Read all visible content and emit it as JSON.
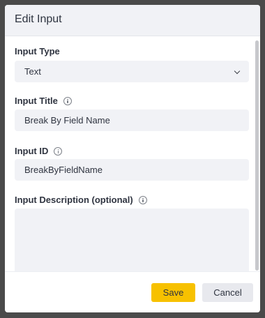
{
  "dialog": {
    "title": "Edit Input",
    "fields": {
      "input_type": {
        "label": "Input Type",
        "value": "Text"
      },
      "input_title": {
        "label": "Input Title",
        "value": "Break By Field Name"
      },
      "input_id": {
        "label": "Input ID",
        "value": "BreakByFieldName"
      },
      "input_description": {
        "label": "Input Description (optional)",
        "value": ""
      }
    },
    "buttons": {
      "save": "Save",
      "cancel": "Cancel"
    }
  },
  "icons": {
    "info": "info-icon",
    "select": "chevron-down-icon"
  },
  "colors": {
    "primary": "#f7c100",
    "panel": "#f1f2f6",
    "backdrop": "#4a4a4a"
  }
}
